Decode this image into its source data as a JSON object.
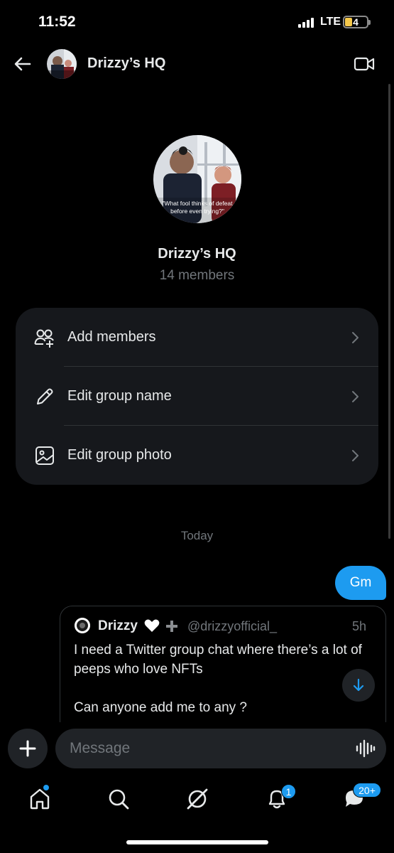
{
  "status_bar": {
    "time": "11:52",
    "network": "LTE",
    "battery": "4",
    "battery_color": "#f5c84b"
  },
  "header": {
    "title": "Drizzy’s HQ",
    "back_icon": "arrow-left-icon",
    "video_icon": "video-camera-icon"
  },
  "group": {
    "photo_caption_line1": "\"What fool thinks of defeat",
    "photo_caption_line2": "before even trying?\"",
    "name": "Drizzy’s HQ",
    "members": "14 members"
  },
  "options": [
    {
      "label": "Add members",
      "icon": "add-people-icon"
    },
    {
      "label": "Edit group name",
      "icon": "pencil-icon"
    },
    {
      "label": "Edit group photo",
      "icon": "image-icon"
    }
  ],
  "chat": {
    "date_separator": "Today",
    "sent_message": "Gm",
    "quoted_post": {
      "name": "Drizzy",
      "handle": "@drizzyofficial_",
      "time": "5h",
      "line1": "I need a Twitter group chat where there’s a lot of peeps who love NFTs",
      "line2": "Can anyone add me to any ?"
    }
  },
  "composer": {
    "placeholder": "Message"
  },
  "nav": {
    "notifications_badge": "1",
    "messages_badge": "20+"
  },
  "colors": {
    "accent": "#1d9bf0",
    "card": "#16181c",
    "muted_text": "#71767b"
  }
}
